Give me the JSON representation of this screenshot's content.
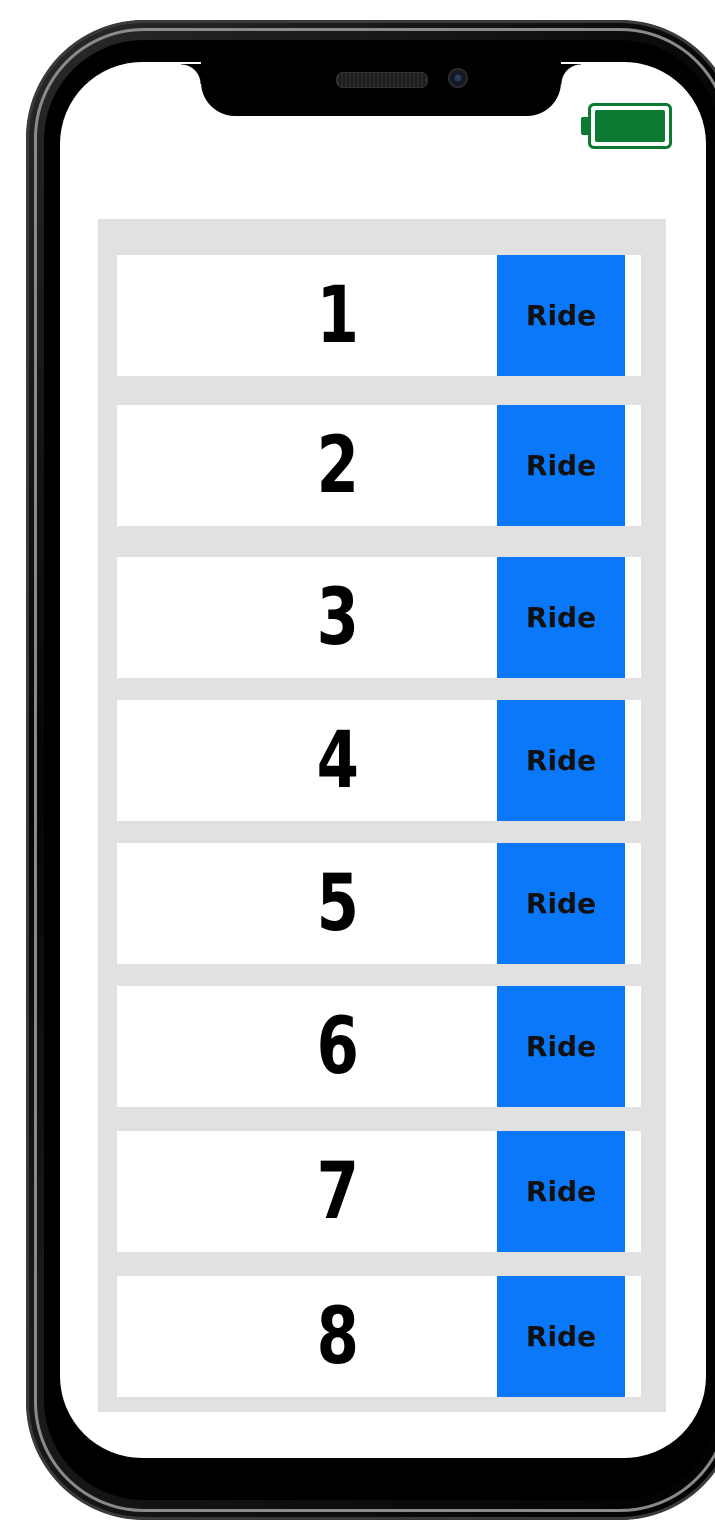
{
  "device": {
    "battery_color": "#0d7a33"
  },
  "colors": {
    "ride_button": "#0a78f8",
    "panel_background": "#e1e1e1",
    "row_background": "#ffffff"
  },
  "rides": [
    {
      "number": "1",
      "button_label": "Ride"
    },
    {
      "number": "2",
      "button_label": "Ride"
    },
    {
      "number": "3",
      "button_label": "Ride"
    },
    {
      "number": "4",
      "button_label": "Ride"
    },
    {
      "number": "5",
      "button_label": "Ride"
    },
    {
      "number": "6",
      "button_label": "Ride"
    },
    {
      "number": "7",
      "button_label": "Ride"
    },
    {
      "number": "8",
      "button_label": "Ride"
    }
  ]
}
